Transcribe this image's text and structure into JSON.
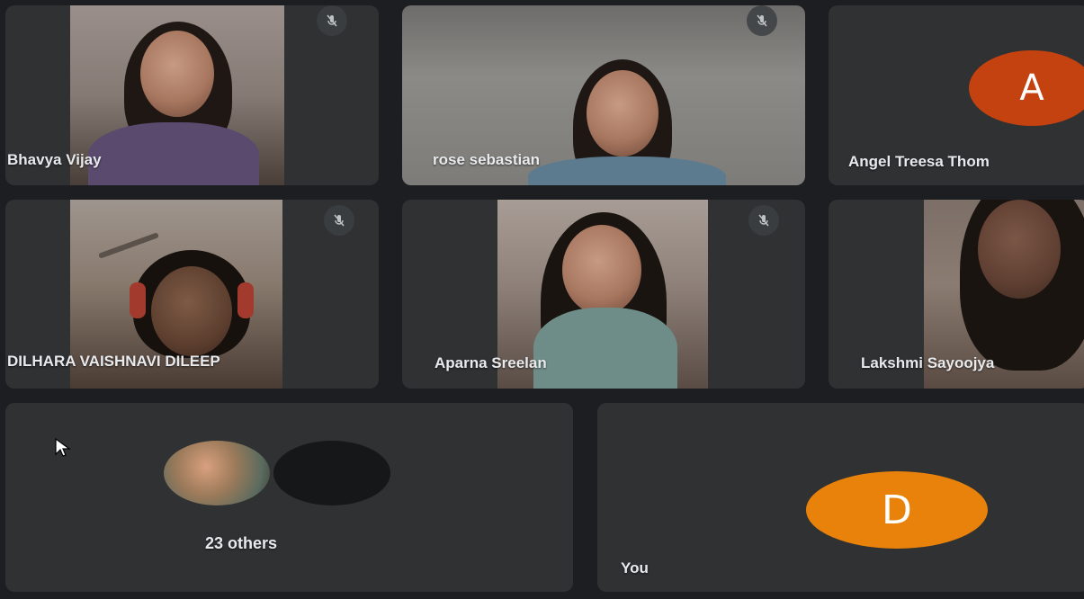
{
  "participants": [
    {
      "name": "Bhavya Vijay",
      "muted": true,
      "video": true
    },
    {
      "name": "rose sebastian",
      "muted": true,
      "video": true
    },
    {
      "name": "Angel Treesa Thom",
      "muted": false,
      "video": false,
      "avatar_letter": "A",
      "avatar_color": "#c4420f"
    },
    {
      "name": "DILHARA VAISHNAVI DILEEP",
      "muted": true,
      "video": true
    },
    {
      "name": "Aparna Sreelan",
      "muted": true,
      "video": true
    },
    {
      "name": "Lakshmi Sayoojya",
      "muted": false,
      "video": true
    }
  ],
  "others": {
    "label": "23 others"
  },
  "self": {
    "label": "You",
    "avatar_letter": "D",
    "avatar_color": "#e8820a"
  },
  "icons": {
    "mute": "mic-off-icon",
    "cursor": "pointer-cursor-icon"
  }
}
